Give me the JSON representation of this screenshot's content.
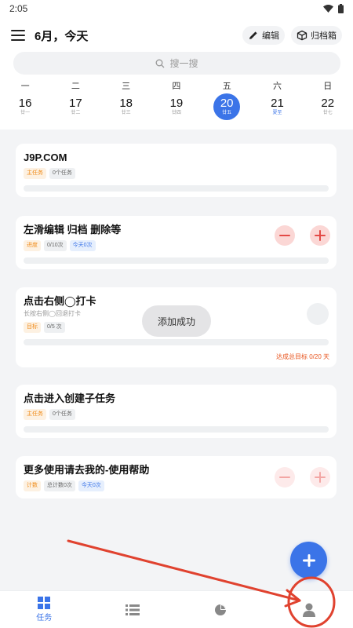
{
  "status_bar": {
    "time": "2:05"
  },
  "header": {
    "title": "6月，今天",
    "edit_label": "编辑",
    "archive_label": "归档箱"
  },
  "search": {
    "placeholder": "搜一搜"
  },
  "week": [
    {
      "name": "一",
      "num": "16",
      "lunar": "廿一"
    },
    {
      "name": "二",
      "num": "17",
      "lunar": "廿二"
    },
    {
      "name": "三",
      "num": "18",
      "lunar": "廿三"
    },
    {
      "name": "四",
      "num": "19",
      "lunar": "廿四"
    },
    {
      "name": "五",
      "num": "20",
      "lunar": "廿五",
      "active": true
    },
    {
      "name": "六",
      "num": "21",
      "lunar": "夏至",
      "holiday": true
    },
    {
      "name": "日",
      "num": "22",
      "lunar": "廿七"
    }
  ],
  "tasks": [
    {
      "title": "J9P.COM",
      "tags": [
        "主任务",
        "0个任务"
      ]
    },
    {
      "title": "左滑编辑 归档 删除等",
      "tags": [
        "进度",
        "0/10次",
        "今天0次"
      ]
    },
    {
      "title": "点击右侧◯打卡",
      "subtitle": "长按右侧◯回退打卡",
      "tags": [
        "目标",
        "0/5 次"
      ],
      "goal": "达成总目标 0/20 天"
    },
    {
      "title": "点击进入创建子任务",
      "tags": [
        "主任务",
        "0个任务"
      ]
    },
    {
      "title": "更多使用请去我的-使用帮助",
      "tags": [
        "计数",
        "总计数0次",
        "今天0次"
      ]
    }
  ],
  "toast": "添加成功",
  "bottom_nav": {
    "tasks_label": "任务"
  },
  "colors": {
    "accent": "#3b74e8",
    "danger": "#e34a46",
    "annotation": "#e0422f"
  }
}
